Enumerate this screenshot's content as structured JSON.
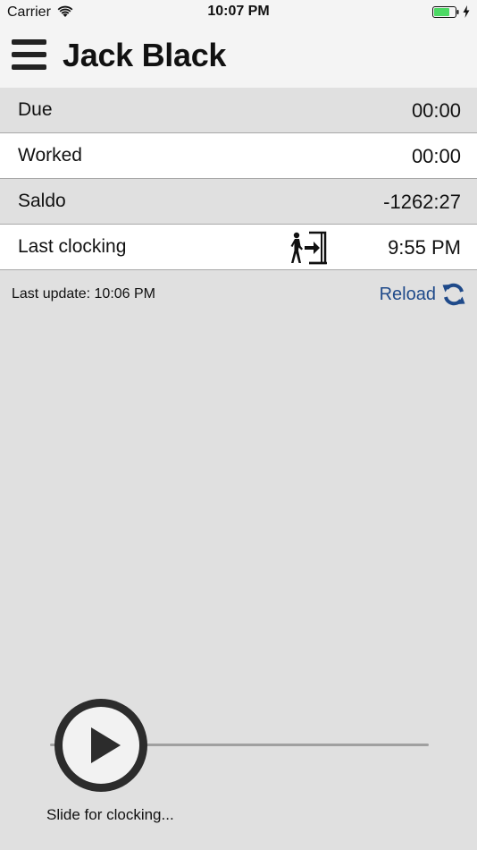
{
  "status_bar": {
    "carrier": "Carrier",
    "time": "10:07 PM",
    "wifi_icon": "wifi-icon",
    "battery_icon": "battery-icon",
    "charging_icon": "charging-bolt-icon",
    "battery_color": "#4cd964"
  },
  "nav": {
    "title": "Jack Black",
    "menu_icon": "hamburger-menu-icon"
  },
  "rows": [
    {
      "label": "Due",
      "value": "00:00"
    },
    {
      "label": "Worked",
      "value": "00:00"
    },
    {
      "label": "Saldo",
      "value": "-1262:27"
    },
    {
      "label": "Last clocking",
      "value": "9:55 PM",
      "icon": "person-entering-door-icon"
    }
  ],
  "update": {
    "last_update": "Last update: 10:06 PM",
    "reload_label": "Reload",
    "reload_icon": "refresh-icon",
    "reload_color": "#1f4a8a"
  },
  "slider": {
    "caption": "Slide for clocking...",
    "knob_icon": "play-icon",
    "value": 0
  }
}
